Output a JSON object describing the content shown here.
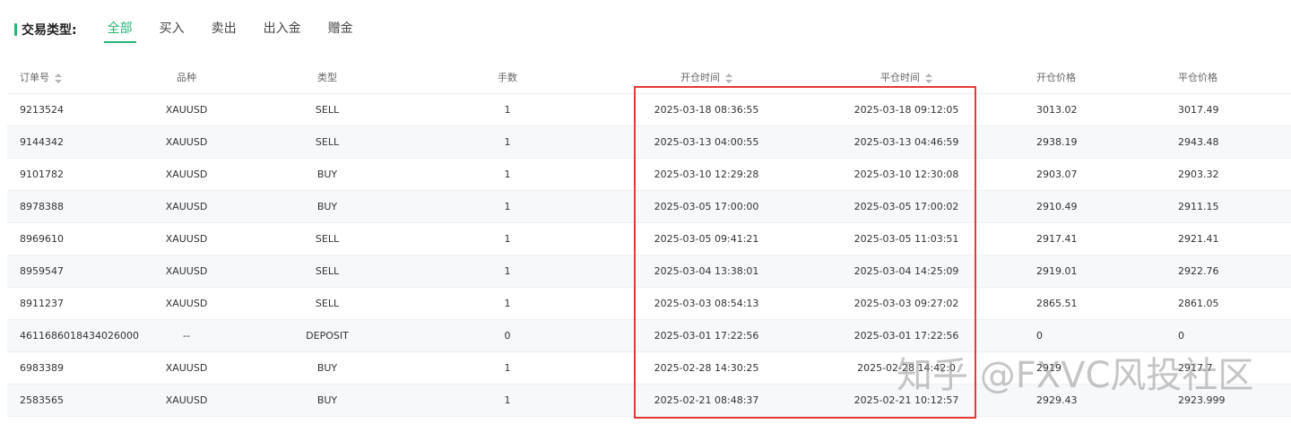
{
  "filter": {
    "label": "交易类型:",
    "tabs": [
      {
        "label": "全部",
        "active": true
      },
      {
        "label": "买入",
        "active": false
      },
      {
        "label": "卖出",
        "active": false
      },
      {
        "label": "出入金",
        "active": false
      },
      {
        "label": "赠金",
        "active": false
      }
    ],
    "accent_color": "#22b573"
  },
  "table": {
    "headers": {
      "order_no": "订单号",
      "symbol": "品种",
      "type": "类型",
      "lots": "手数",
      "open_time": "开仓时间",
      "close_time": "平仓时间",
      "open_price": "开仓价格",
      "close_price": "平仓价格"
    },
    "rows": [
      {
        "order_no": "9213524",
        "symbol": "XAUUSD",
        "type": "SELL",
        "lots": "1",
        "open_time": "2025-03-18 08:36:55",
        "close_time": "2025-03-18 09:12:05",
        "open_price": "3013.02",
        "close_price": "3017.49"
      },
      {
        "order_no": "9144342",
        "symbol": "XAUUSD",
        "type": "SELL",
        "lots": "1",
        "open_time": "2025-03-13 04:00:55",
        "close_time": "2025-03-13 04:46:59",
        "open_price": "2938.19",
        "close_price": "2943.48"
      },
      {
        "order_no": "9101782",
        "symbol": "XAUUSD",
        "type": "BUY",
        "lots": "1",
        "open_time": "2025-03-10 12:29:28",
        "close_time": "2025-03-10 12:30:08",
        "open_price": "2903.07",
        "close_price": "2903.32"
      },
      {
        "order_no": "8978388",
        "symbol": "XAUUSD",
        "type": "BUY",
        "lots": "1",
        "open_time": "2025-03-05 17:00:00",
        "close_time": "2025-03-05 17:00:02",
        "open_price": "2910.49",
        "close_price": "2911.15"
      },
      {
        "order_no": "8969610",
        "symbol": "XAUUSD",
        "type": "SELL",
        "lots": "1",
        "open_time": "2025-03-05 09:41:21",
        "close_time": "2025-03-05 11:03:51",
        "open_price": "2917.41",
        "close_price": "2921.41"
      },
      {
        "order_no": "8959547",
        "symbol": "XAUUSD",
        "type": "SELL",
        "lots": "1",
        "open_time": "2025-03-04 13:38:01",
        "close_time": "2025-03-04 14:25:09",
        "open_price": "2919.01",
        "close_price": "2922.76"
      },
      {
        "order_no": "8911237",
        "symbol": "XAUUSD",
        "type": "SELL",
        "lots": "1",
        "open_time": "2025-03-03 08:54:13",
        "close_time": "2025-03-03 09:27:02",
        "open_price": "2865.51",
        "close_price": "2861.05"
      },
      {
        "order_no": "4611686018434026000",
        "symbol": "--",
        "type": "DEPOSIT",
        "lots": "0",
        "open_time": "2025-03-01 17:22:56",
        "close_time": "2025-03-01 17:22:56",
        "open_price": "0",
        "close_price": "0"
      },
      {
        "order_no": "6983389",
        "symbol": "XAUUSD",
        "type": "BUY",
        "lots": "1",
        "open_time": "2025-02-28 14:30:25",
        "close_time": "2025-02-28 14:42:0",
        "open_price": "2919",
        "close_price": "2917.7"
      },
      {
        "order_no": "2583565",
        "symbol": "XAUUSD",
        "type": "BUY",
        "lots": "1",
        "open_time": "2025-02-21 08:48:37",
        "close_time": "2025-02-21 10:12:57",
        "open_price": "2929.43",
        "close_price": "2923.999"
      }
    ]
  },
  "highlight_color": "#e53935",
  "watermark": "知乎 @FXVC风投社区"
}
